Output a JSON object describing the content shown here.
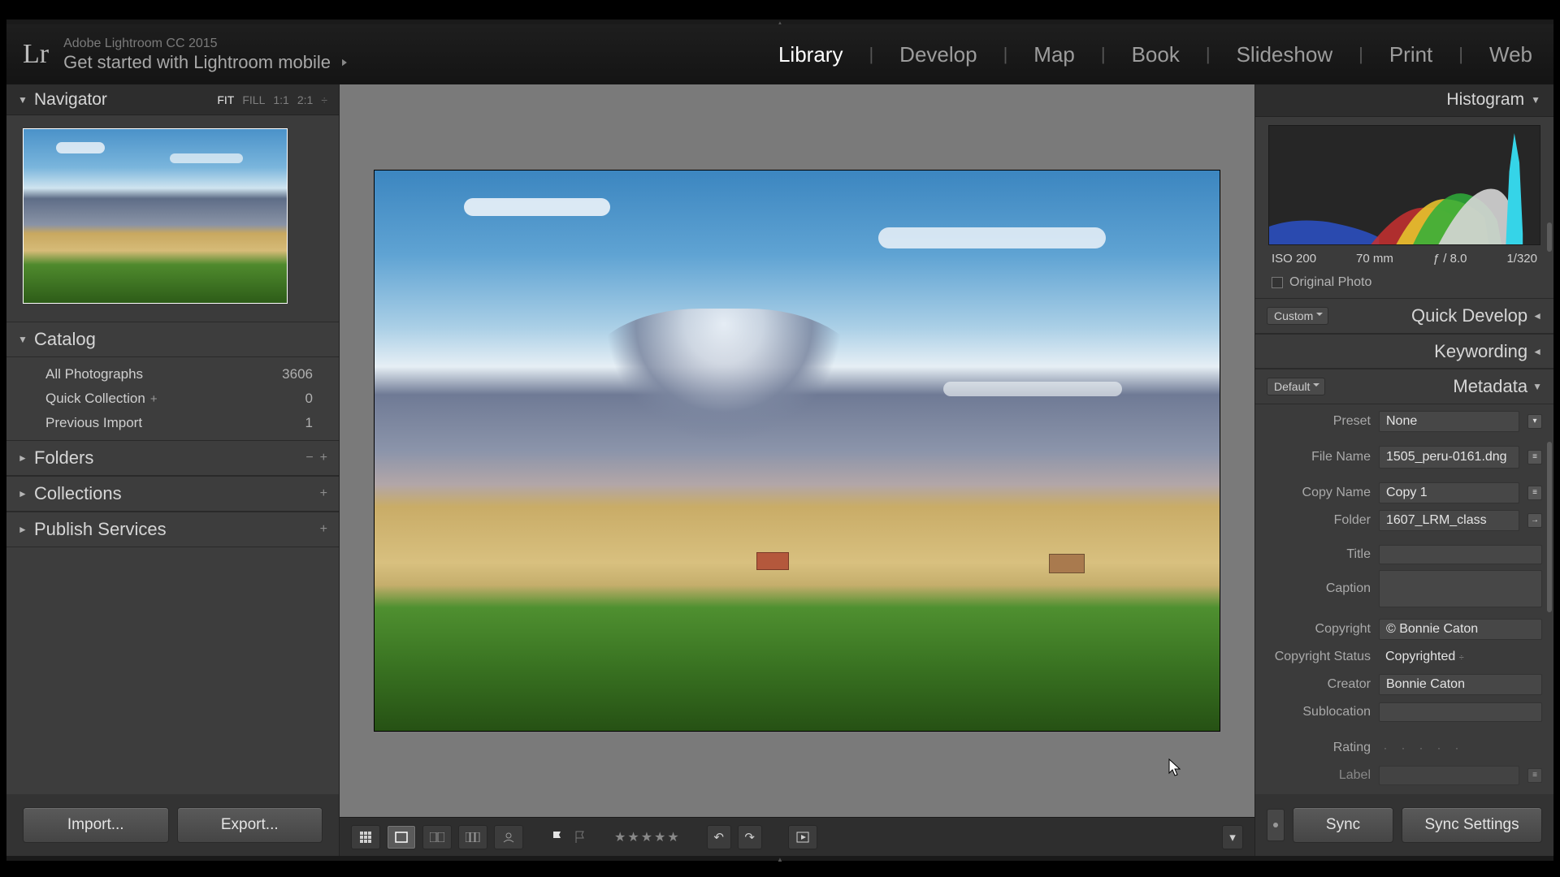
{
  "app": {
    "title": "Adobe Lightroom CC 2015",
    "mobile_prompt": "Get started with Lightroom mobile"
  },
  "modules": {
    "library": "Library",
    "develop": "Develop",
    "map": "Map",
    "book": "Book",
    "slideshow": "Slideshow",
    "print": "Print",
    "web": "Web"
  },
  "navigator": {
    "title": "Navigator",
    "fit": "FIT",
    "fill": "FILL",
    "z11": "1:1",
    "z21": "2:1"
  },
  "catalog": {
    "title": "Catalog",
    "all_label": "All Photographs",
    "all_count": "3606",
    "quick_label": "Quick Collection",
    "quick_count": "0",
    "prev_label": "Previous Import",
    "prev_count": "1"
  },
  "folders": {
    "title": "Folders"
  },
  "collections": {
    "title": "Collections"
  },
  "publish": {
    "title": "Publish Services"
  },
  "buttons": {
    "import": "Import...",
    "export": "Export...",
    "sync": "Sync",
    "sync_settings": "Sync Settings"
  },
  "histogram": {
    "title": "Histogram",
    "iso": "ISO 200",
    "focal": "70 mm",
    "aperture": "ƒ / 8.0",
    "shutter": "1/320",
    "original": "Original Photo"
  },
  "quick_develop": {
    "title": "Quick Develop",
    "preset_dd": "Custom"
  },
  "keywording": {
    "title": "Keywording"
  },
  "metadata": {
    "title": "Metadata",
    "dd": "Default",
    "preset_label": "Preset",
    "preset_value": "None",
    "filename_label": "File Name",
    "filename_value": "1505_peru-0161.dng",
    "copyname_label": "Copy Name",
    "copyname_value": "Copy 1",
    "folder_label": "Folder",
    "folder_value": "1607_LRM_class",
    "title_label": "Title",
    "title_value": "",
    "caption_label": "Caption",
    "caption_value": "",
    "copyright_label": "Copyright",
    "copyright_value": "© Bonnie Caton",
    "cstatus_label": "Copyright Status",
    "cstatus_value": "Copyrighted",
    "creator_label": "Creator",
    "creator_value": "Bonnie Caton",
    "subloc_label": "Sublocation",
    "subloc_value": "",
    "rating_label": "Rating",
    "label_label": "Label"
  }
}
